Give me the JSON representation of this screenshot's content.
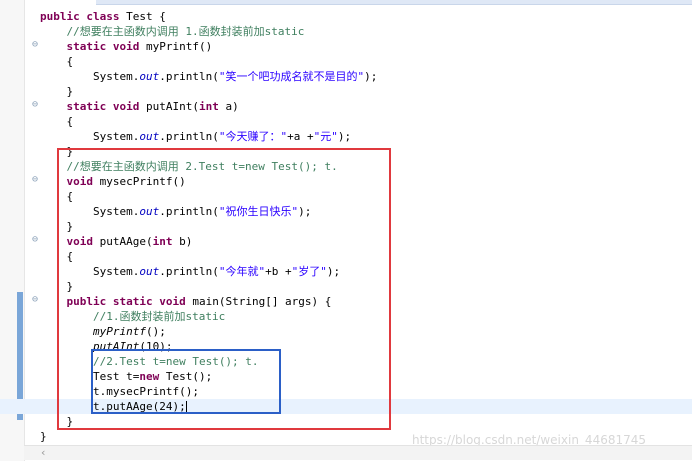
{
  "editor": {
    "lines": [
      [
        {
          "t": "public class ",
          "c": "kw"
        },
        {
          "t": "Test {"
        }
      ],
      [
        {
          "t": "    "
        },
        {
          "t": "//想要在主函数内调用 1.函数封装前加static",
          "c": "cm"
        }
      ],
      [
        {
          "t": "    "
        },
        {
          "t": "static void ",
          "c": "kw"
        },
        {
          "t": "myPrintf()"
        }
      ],
      [
        {
          "t": "    {"
        }
      ],
      [
        {
          "t": "        System."
        },
        {
          "t": "out",
          "c": "fld"
        },
        {
          "t": ".println("
        },
        {
          "t": "\"笑一个吧功成名就不是目的\"",
          "c": "str"
        },
        {
          "t": ");"
        }
      ],
      [
        {
          "t": "    }"
        }
      ],
      [
        {
          "t": "    "
        },
        {
          "t": "static void ",
          "c": "kw"
        },
        {
          "t": "putAInt("
        },
        {
          "t": "int",
          "c": "kw"
        },
        {
          "t": " a)"
        }
      ],
      [
        {
          "t": "    {"
        }
      ],
      [
        {
          "t": "        System."
        },
        {
          "t": "out",
          "c": "fld"
        },
        {
          "t": ".println("
        },
        {
          "t": "\"今天赚了：\"",
          "c": "str"
        },
        {
          "t": "+a +"
        },
        {
          "t": "\"元\"",
          "c": "str"
        },
        {
          "t": ");"
        }
      ],
      [
        {
          "t": "    }"
        }
      ],
      [
        {
          "t": "    "
        },
        {
          "t": "//想要在主函数内调用 2.Test t=new Test(); t.",
          "c": "cm"
        }
      ],
      [
        {
          "t": "    "
        },
        {
          "t": "void ",
          "c": "kw"
        },
        {
          "t": "mysecPrintf()"
        }
      ],
      [
        {
          "t": "    {"
        }
      ],
      [
        {
          "t": "        System."
        },
        {
          "t": "out",
          "c": "fld"
        },
        {
          "t": ".println("
        },
        {
          "t": "\"祝你生日快乐\"",
          "c": "str"
        },
        {
          "t": ");"
        }
      ],
      [
        {
          "t": "    }"
        }
      ],
      [
        {
          "t": "    "
        },
        {
          "t": "void ",
          "c": "kw"
        },
        {
          "t": "putAAge("
        },
        {
          "t": "int",
          "c": "kw"
        },
        {
          "t": " b)"
        }
      ],
      [
        {
          "t": "    {"
        }
      ],
      [
        {
          "t": "        System."
        },
        {
          "t": "out",
          "c": "fld"
        },
        {
          "t": ".println("
        },
        {
          "t": "\"今年就\"",
          "c": "str"
        },
        {
          "t": "+b +"
        },
        {
          "t": "\"岁了\"",
          "c": "str"
        },
        {
          "t": ");"
        }
      ],
      [
        {
          "t": "    }"
        }
      ],
      [
        {
          "t": "    "
        },
        {
          "t": "public static void ",
          "c": "kw"
        },
        {
          "t": "main(String[] args) {"
        }
      ],
      [
        {
          "t": "        "
        },
        {
          "t": "//1.函数封装前加static",
          "c": "cm"
        }
      ],
      [
        {
          "t": "        "
        },
        {
          "t": "myPrintf",
          "c": "it"
        },
        {
          "t": "();"
        }
      ],
      [
        {
          "t": "        "
        },
        {
          "t": "putAInt",
          "c": "it"
        },
        {
          "t": "(10);"
        }
      ],
      [
        {
          "t": "        "
        },
        {
          "t": "//2.Test t=new Test(); t.",
          "c": "cm"
        }
      ],
      [
        {
          "t": "        Test t="
        },
        {
          "t": "new",
          "c": "kw"
        },
        {
          "t": " Test();"
        }
      ],
      [
        {
          "t": "        t.mysecPrintf();"
        }
      ],
      [
        {
          "t": "        t.putAAge(24);"
        }
      ],
      [
        {
          "t": "    }"
        }
      ],
      [
        {
          "t": "}"
        }
      ]
    ]
  },
  "watermark": "https://blog.csdn.net/weixin_44681745",
  "colors": {
    "keyword": "#7f0055",
    "comment": "#3f7f5f",
    "string": "#2a00ff",
    "field": "#0000c0",
    "annotation_red": "#e0393e",
    "annotation_blue": "#2b5fc7"
  },
  "icons": {
    "fold": "collapse-marker-icon",
    "scroll_left": "scroll-left-arrow-icon"
  }
}
